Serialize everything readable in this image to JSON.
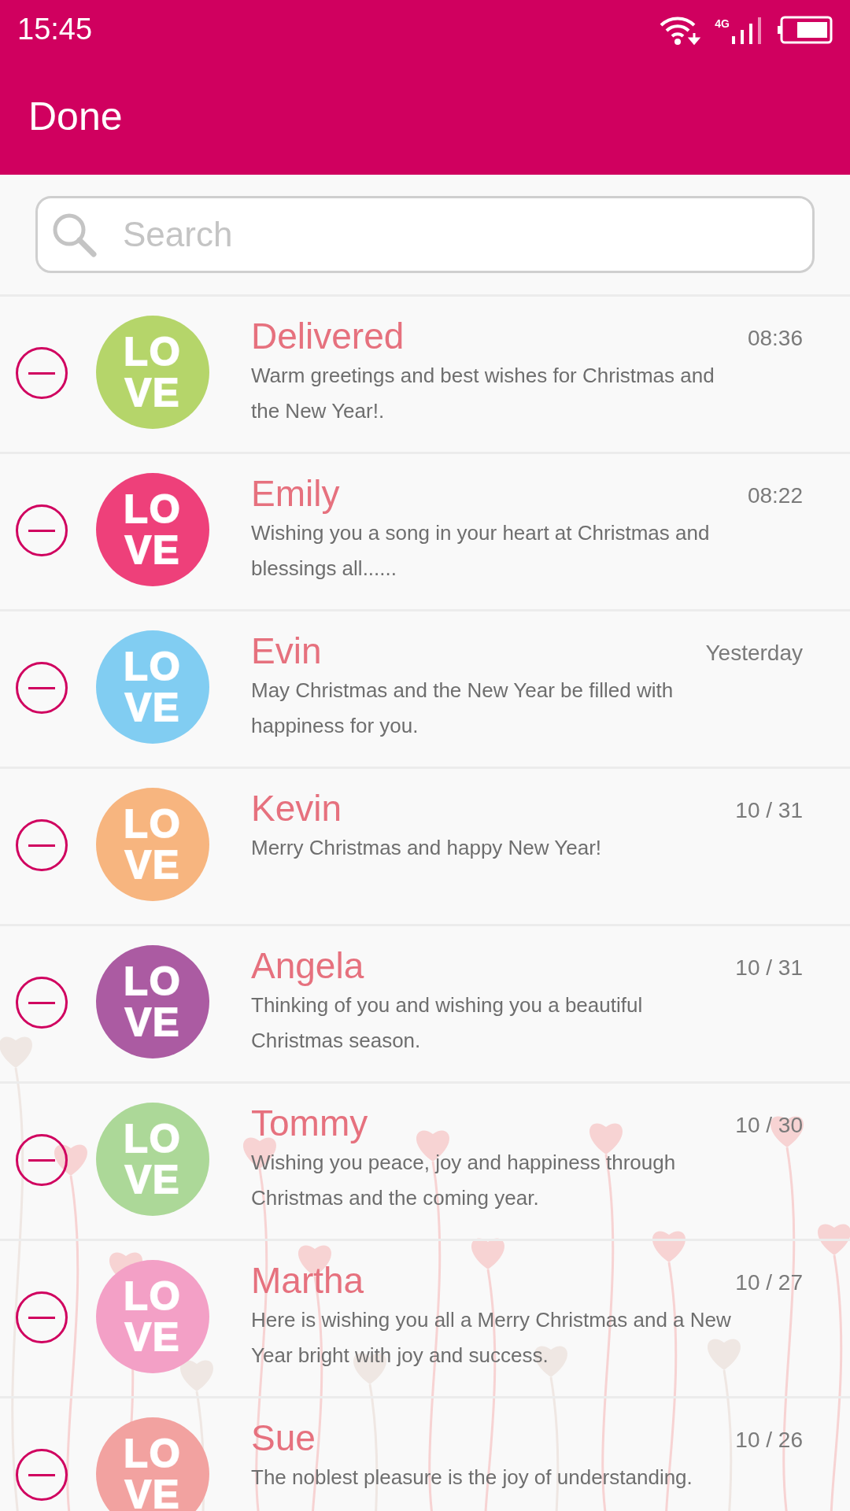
{
  "status_bar": {
    "time": "15:45",
    "network": "4G"
  },
  "app_bar": {
    "action": "Done"
  },
  "search": {
    "placeholder": "Search"
  },
  "conversations": [
    {
      "name": "Delivered",
      "time": "08:36",
      "message": "Warm greetings and best wishes for Christmas and the New Year!.",
      "avatar_lines": [
        "LO",
        "VE"
      ],
      "color": "#b5d56a"
    },
    {
      "name": "Emily",
      "time": "08:22",
      "message": "Wishing you a song in your heart at Christmas and blessings all......",
      "avatar_lines": [
        "LO",
        "VE"
      ],
      "color": "#ee407a"
    },
    {
      "name": "Evin",
      "time": "Yesterday",
      "message": "May Christmas and the New Year be filled with happiness for you.",
      "avatar_lines": [
        "LO",
        "VE"
      ],
      "color": "#81cdf2"
    },
    {
      "name": "Kevin",
      "time": "10 / 31",
      "message": "Merry Christmas and happy New Year!",
      "avatar_lines": [
        "LO",
        "VE"
      ],
      "color": "#f7b57f"
    },
    {
      "name": "Angela",
      "time": "10 / 31",
      "message": "Thinking of you and wishing you a beautiful Christmas season.",
      "avatar_lines": [
        "LO",
        "VE"
      ],
      "color": "#ab5ba2"
    },
    {
      "name": "Tommy",
      "time": "10 / 30",
      "message": "Wishing you peace, joy and happiness through Christmas and the coming year.",
      "avatar_lines": [
        "LO",
        "VE"
      ],
      "color": "#acd898"
    },
    {
      "name": "Martha",
      "time": "10 / 27",
      "message": "Here is wishing you all a Merry Christmas and a New Year bright with joy and success.",
      "avatar_lines": [
        "LO",
        "VE"
      ],
      "color": "#f3a0c6"
    },
    {
      "name": "Sue",
      "time": "10 / 26",
      "message": "The noblest pleasure is the joy of understanding.",
      "avatar_lines": [
        "LO",
        "VE"
      ],
      "color": "#f2a2a0"
    }
  ]
}
